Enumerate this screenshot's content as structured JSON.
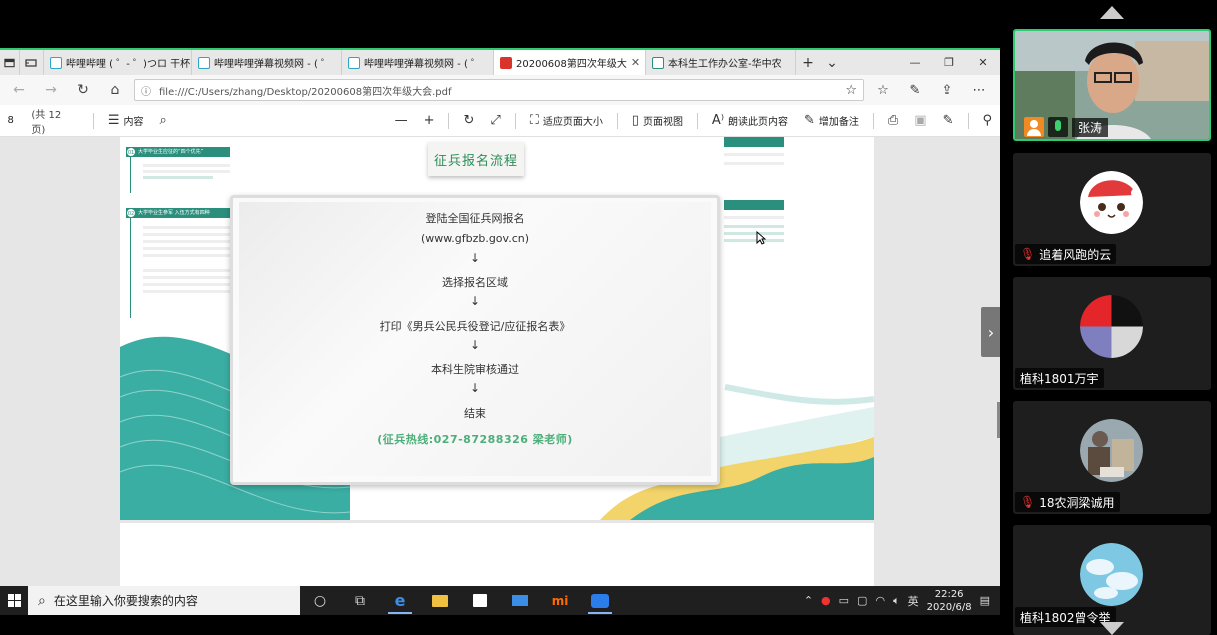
{
  "browser": {
    "tabs": [
      {
        "label": "哔哩哔哩 ( ゜- ゜)つロ 干杯",
        "color": "#2aa6c9"
      },
      {
        "label": "哔哩哔哩弹幕视频网 - ( ゜",
        "color": "#2aa6c9"
      },
      {
        "label": "哔哩哔哩弹幕视频网 - ( ゜",
        "color": "#2aa6c9"
      },
      {
        "label": "20200608第四次年级大",
        "color": "#d9332b"
      },
      {
        "label": "本科生工作办公室-华中农",
        "color": "#2a8f7c"
      }
    ],
    "url": "file:///C:/Users/zhang/Desktop/20200608第四次年级大会.pdf"
  },
  "pdf_toolbar": {
    "page_number": "8",
    "total_pages": "(共 12 页)",
    "contents": "内容",
    "fit_page": "适应页面大小",
    "page_view": "页面视图",
    "read_aloud": "朗读此页内容",
    "add_note": "增加备注"
  },
  "pdf_page": {
    "left_section1_title": "大学毕业生应征的“四个优先”",
    "left_section1_num": "01",
    "left_section2_title": "大学毕业生参军  入伍方式有四种",
    "left_section2_num": "02",
    "flow_title": "征兵报名流程",
    "steps": [
      "登陆全国征兵网报名",
      "(www.gfbzb.gov.cn)",
      "选择报名区域",
      "打印《男兵公民兵役登记/应征报名表》",
      "本科生院审核通过",
      "结束"
    ],
    "arrow": "↓",
    "hotline": "(征兵热线:027-87288326  梁老师)"
  },
  "taskbar": {
    "search_placeholder": "在这里输入你要搜索的内容",
    "ime": "英",
    "time": "22:26",
    "date": "2020/6/8"
  },
  "participants": [
    {
      "name": "张涛",
      "muted": false
    },
    {
      "name": "追着风跑的云",
      "muted": true
    },
    {
      "name": "植科1801万宇",
      "muted": false
    },
    {
      "name": "18农洞梁诚用",
      "muted": true
    },
    {
      "name": "植科1802曾令举",
      "muted": false
    }
  ]
}
